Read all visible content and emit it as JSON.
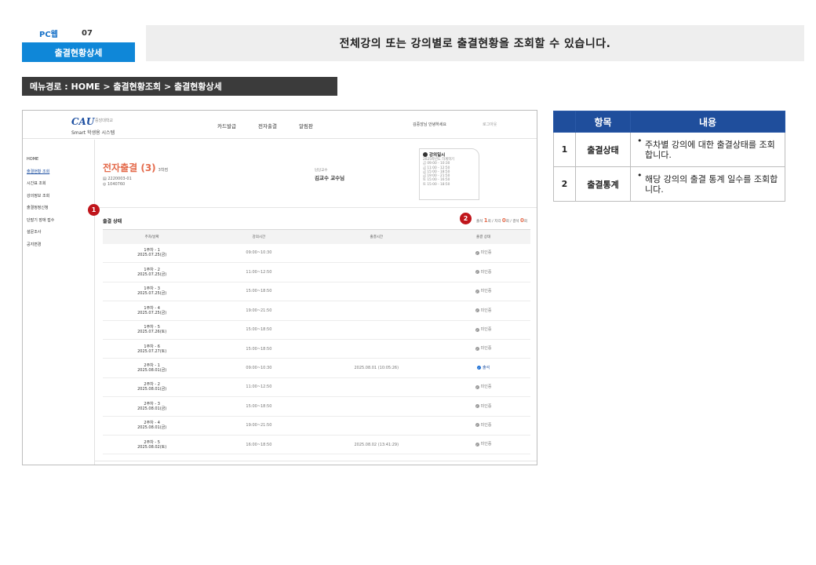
{
  "header": {
    "platform": "PC웹",
    "page_no": "07",
    "page_name": "출결현황상세",
    "banner": "전체강의 또는 강의별로 출결현황을 조회할 수 있습니다."
  },
  "menu_path": "메뉴경로 : HOME > 출결현황조회 > 출결현황상세",
  "mock": {
    "logo_mark": "CAU",
    "logo_university": "중앙대학교",
    "logo_sub": "Smart 학생용 시스템",
    "gnb": [
      "카드발급",
      "전자출결",
      "알림판"
    ],
    "greeting": "김중앙님 안녕하세요",
    "logout": "로그아웃",
    "lnb": [
      {
        "label": "HOME",
        "active": false
      },
      {
        "label": "출결현황 조회",
        "active": true
      },
      {
        "label": "시간표 조회",
        "active": false
      },
      {
        "label": "강의정보 조회",
        "active": false
      },
      {
        "label": "출결정정신청",
        "active": false
      },
      {
        "label": "단말기 장애 접수",
        "active": false
      },
      {
        "label": "설문조사",
        "active": false
      },
      {
        "label": "공지변경",
        "active": false
      }
    ],
    "course": {
      "title": "전자출결 (3)",
      "credit": "3학점",
      "code": "2220003-01",
      "room": "1040760",
      "professor_label": "담당교수",
      "professor": "김교수 교수님"
    },
    "schedule": {
      "title": "강의일시",
      "lines": [
        "2025학년도 하계학기",
        "금 09:00 - 10:30",
        "금 11:00 - 12:50",
        "금 15:00 - 18:50",
        "금 19:00 - 21:50",
        "토 15:00 - 16:50",
        "토 15:00 - 18:50"
      ]
    },
    "section_title": "출결 상태",
    "stats": {
      "attend_label": "출석",
      "attend": "1",
      "unit1": "회",
      "late_label": "지각",
      "late": "0",
      "unit2": "회",
      "absent_label": "결석",
      "absent": "0",
      "unit3": "회"
    },
    "table_headers": [
      "주차/날짜",
      "강의시간",
      "출결시간",
      "출결 상태"
    ],
    "rows": [
      {
        "week": "1주차 - 1",
        "date": "2025.07.25(금)",
        "time": "09:00~10:30",
        "att_time": "",
        "status": "미인증",
        "ok": false
      },
      {
        "week": "1주차 - 2",
        "date": "2025.07.25(금)",
        "time": "11:00~12:50",
        "att_time": "",
        "status": "미인증",
        "ok": false
      },
      {
        "week": "1주차 - 3",
        "date": "2025.07.25(금)",
        "time": "15:00~18:50",
        "att_time": "",
        "status": "미인증",
        "ok": false
      },
      {
        "week": "1주차 - 4",
        "date": "2025.07.25(금)",
        "time": "19:00~21:50",
        "att_time": "",
        "status": "미인증",
        "ok": false
      },
      {
        "week": "1주차 - 5",
        "date": "2025.07.26(토)",
        "time": "15:00~18:50",
        "att_time": "",
        "status": "미인증",
        "ok": false
      },
      {
        "week": "1주차 - 6",
        "date": "2025.07.27(토)",
        "time": "15:00~18:50",
        "att_time": "",
        "status": "미인증",
        "ok": false
      },
      {
        "week": "2주차 - 1",
        "date": "2025.08.01(금)",
        "time": "09:00~10:30",
        "att_time": "2025.08.01 (10:05:26)",
        "status": "출석",
        "ok": true
      },
      {
        "week": "2주차 - 2",
        "date": "2025.08.01(금)",
        "time": "11:00~12:50",
        "att_time": "",
        "status": "미인증",
        "ok": false
      },
      {
        "week": "2주차 - 3",
        "date": "2025.08.01(금)",
        "time": "15:00~18:50",
        "att_time": "",
        "status": "미인증",
        "ok": false
      },
      {
        "week": "2주차 - 4",
        "date": "2025.08.01(금)",
        "time": "19:00~21:50",
        "att_time": "",
        "status": "미인증",
        "ok": false
      },
      {
        "week": "2주차 - 5",
        "date": "2025.08.02(토)",
        "time": "16:00~18:50",
        "att_time": "2025.08.02 (13:41:29)",
        "status": "미인증",
        "ok": false
      }
    ]
  },
  "badges": [
    "1",
    "2"
  ],
  "desc": {
    "headers": [
      "",
      "항목",
      "내용"
    ],
    "rows": [
      {
        "no": "1",
        "item": "출결상태",
        "text": "주차별 강의에 대한 출결상태를 조회합니다."
      },
      {
        "no": "2",
        "item": "출결통계",
        "text": "해당 강의의 출결 통계 일수를 조회합니다."
      }
    ]
  },
  "colors": {
    "tag_blue": "#0f87d8",
    "header_navy": "#1f4e9c",
    "menu_dark": "#3b3b3b",
    "course_accent": "#e46b4c",
    "badge_red": "#c0151b"
  }
}
